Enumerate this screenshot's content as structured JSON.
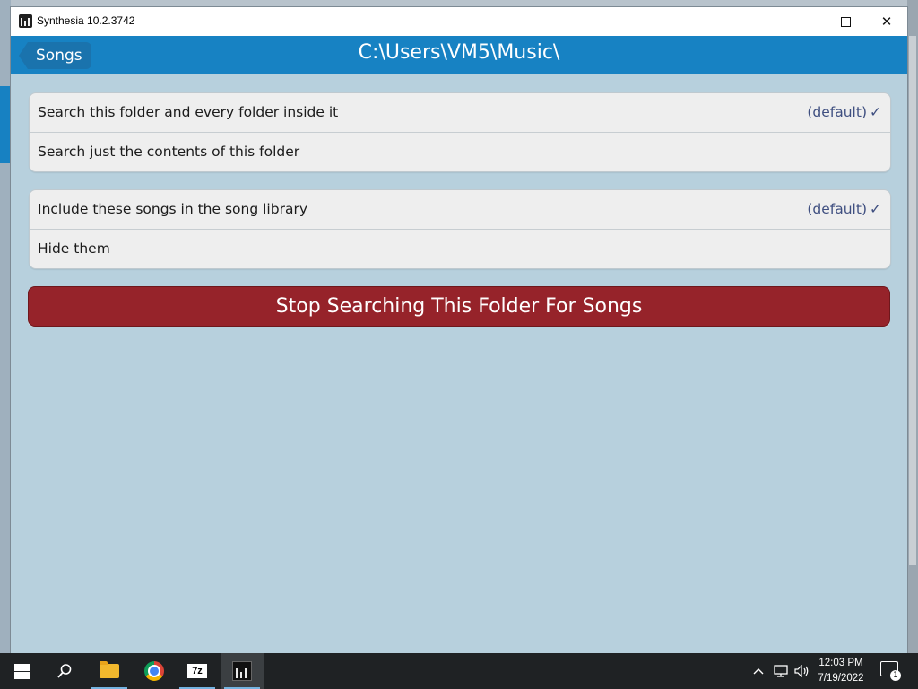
{
  "window": {
    "title": "Synthesia 10.2.3742",
    "minimize_label": "",
    "maximize_label": "",
    "close_label": "✕"
  },
  "header": {
    "back_label": "Songs",
    "path": "C:\\Users\\VM5\\Music\\"
  },
  "search_options": [
    {
      "label": "Search this folder and every folder inside it",
      "default_text": "(default)",
      "checked": true
    },
    {
      "label": "Search just the contents of this folder",
      "default_text": "",
      "checked": false
    }
  ],
  "library_options": [
    {
      "label": "Include these songs in the song library",
      "default_text": "(default)",
      "checked": true
    },
    {
      "label": "Hide them",
      "default_text": "",
      "checked": false
    }
  ],
  "check_glyph": "✓",
  "stop_button": {
    "label": "Stop Searching This Folder For Songs",
    "color": "#96232a"
  },
  "taskbar": {
    "apps": [
      "start-icon",
      "search-icon",
      "file-explorer-icon",
      "chrome-icon",
      "7zip-icon",
      "synthesia-icon"
    ],
    "sevenzip_text": "7z",
    "tray_chevron": "^",
    "time": "12:03 PM",
    "date": "7/19/2022",
    "notification_count": "1"
  },
  "colors": {
    "header": "#1782c3",
    "background": "#b7d0dd",
    "accent_text": "#3f4f80"
  }
}
